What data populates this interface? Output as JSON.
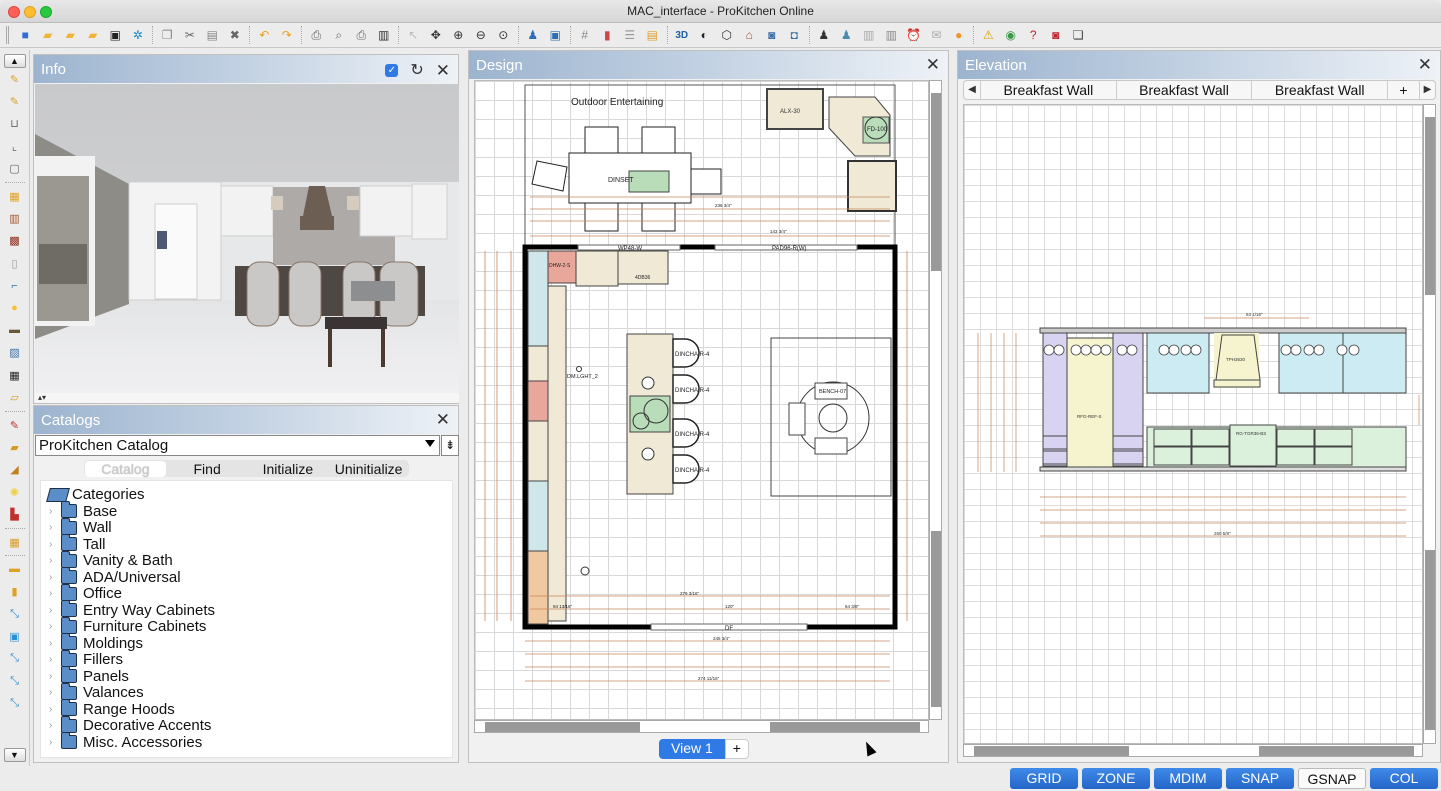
{
  "window": {
    "title": "MAC_interface - ProKitchen Online"
  },
  "toolbar": {
    "groups": [
      [
        "new-icon",
        "open-icon",
        "open-folder-icon",
        "open-recent-icon",
        "save-icon",
        "settings-icon"
      ],
      [
        "copy-icon",
        "cut-icon",
        "paste-icon",
        "delete-icon"
      ],
      [
        "undo-icon",
        "redo-icon"
      ],
      [
        "print-setup-icon",
        "print-preview-icon",
        "print-icon",
        "export-icon"
      ],
      [
        "select-icon",
        "move-icon",
        "zoom-in-icon",
        "zoom-out-icon",
        "zoom-fit-icon"
      ],
      [
        "find-user-icon",
        "zoom-window-icon"
      ],
      [
        "grid-icon",
        "column-icon",
        "list-icon",
        "layout-icon"
      ],
      [
        "3d-icon",
        "toggle-icon",
        "box-icon",
        "house-icon",
        "camera-icon",
        "photo-icon"
      ],
      [
        "person-cabinet-icon",
        "person-cabinet-2-icon",
        "cabinet-list-icon",
        "cabinet-add-icon",
        "alarm-icon",
        "mail-icon",
        "ez-icon"
      ],
      [
        "warning-icon",
        "support-icon",
        "help-icon",
        "presentation-icon",
        "chat-icon"
      ]
    ]
  },
  "left_toolbar": {
    "items": [
      "draw-wall-icon",
      "draw-wall-dotted-icon",
      "room-u-icon",
      "room-l-icon",
      "room-square-icon",
      "base-cabinet-icon",
      "wall-cabinet-icon",
      "tall-cabinet-icon",
      "appliance-icon",
      "faucet-icon",
      "light-icon",
      "furniture-icon",
      "picture-icon",
      "panel-icon",
      "countertop-icon",
      "edit-countertop-icon",
      "add-molding-icon",
      "molding-icon",
      "bulb-icon",
      "door-style-icon",
      "edit-room-icon",
      "ruler-horizontal-icon",
      "ruler-vertical-icon",
      "dimension-icon",
      "grid-snap-icon",
      "dimension-2-icon",
      "dimension-3-icon",
      "dimension-4-icon"
    ]
  },
  "info_panel": {
    "title": "Info",
    "checkbox_checked": true
  },
  "catalogs_panel": {
    "title": "Catalogs",
    "selected_catalog": "ProKitchen Catalog",
    "tabs": [
      {
        "label": "Catalog",
        "active": true
      },
      {
        "label": "Find",
        "active": false
      },
      {
        "label": "Initialize",
        "active": false
      },
      {
        "label": "Uninitialize",
        "active": false
      }
    ],
    "tree_root": "Categories",
    "categories": [
      "Base",
      "Wall",
      "Tall",
      "Vanity & Bath",
      "ADA/Universal",
      "Office",
      "Entry Way Cabinets",
      "Furniture Cabinets",
      "Moldings",
      "Fillers",
      "Panels",
      "Valances",
      "Range Hoods",
      "Decorative Accents",
      "Misc. Accessories"
    ]
  },
  "design_panel": {
    "title": "Design",
    "plan_labels": {
      "outdoor": "Outdoor Entertaining",
      "dinset": "DINSET",
      "fd100": "FD-100",
      "alx": "ALX-30",
      "wp48": "WP48-W",
      "pad": "PAD96-R(W)",
      "dhw": "DHW-2-S",
      "db36": "4DB36",
      "light": "DM.LGHT_2",
      "df": "DF",
      "dinchair": "DINCHAIR-4",
      "bench": "BENCH-07",
      "dim1": "279 3/16\"",
      "dim2": "120\"",
      "dim3": "64 3/8\"",
      "dim4": "94 13/16\"",
      "dim5": "245 3/4\"",
      "dim6": "274 11/16\"",
      "dim7": "236 3/4\"",
      "dim8": "143 3/4\""
    },
    "view_tabs": [
      {
        "label": "View 1",
        "active": true
      }
    ],
    "add_view_label": "+"
  },
  "elevation_panel": {
    "title": "Elevation",
    "tabs": [
      "Breakfast Wall",
      "Breakfast Wall",
      "Breakfast Wall"
    ],
    "add_tab_label": "+",
    "labels": {
      "hood": "TPH3630",
      "fridge": "RFG-REF-S",
      "range": "RG-TGR36-BS",
      "top_dim": "63 1/16\"",
      "total": "260 5/8\""
    }
  },
  "status_buttons": [
    {
      "label": "GRID",
      "active": true
    },
    {
      "label": "ZONE",
      "active": true
    },
    {
      "label": "MDIM",
      "active": true
    },
    {
      "label": "SNAP",
      "active": true
    },
    {
      "label": "GSNAP",
      "active": false
    },
    {
      "label": "COL",
      "active": true
    }
  ],
  "colors": {
    "accent": "#2f7ae5",
    "panel_header_start": "#9db4cf",
    "wall": "#000080",
    "cabinet_beige": "#efe9d6",
    "cabinet_blue": "#cfe6ea",
    "cabinet_red": "#e8a79a",
    "cabinet_orange": "#f0c9a0",
    "island_green": "#b9dcb9",
    "elev_purple": "#d7d3f0",
    "elev_yellow": "#f5f4cf",
    "elev_blue": "#cdebf2",
    "elev_green": "#dcf1dc",
    "dimension": "#c8855a"
  }
}
